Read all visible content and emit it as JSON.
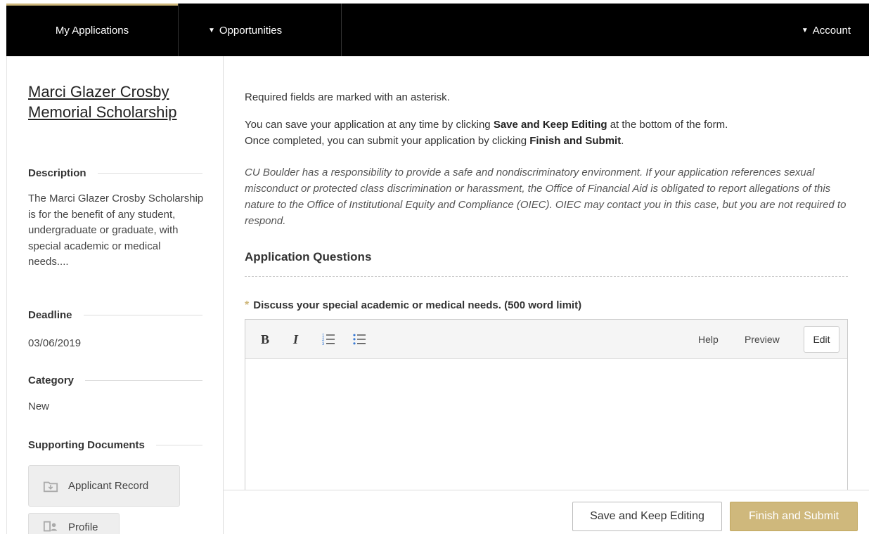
{
  "nav": {
    "my_applications": "My Applications",
    "opportunities": "Opportunities",
    "account": "Account",
    "caret": "▼"
  },
  "sidebar": {
    "title": "Marci Glazer Crosby Memorial Scholarship",
    "description_heading": "Description",
    "description_text": "The Marci Glazer Crosby Scholarship is for the benefit of any student, undergraduate or graduate, with special academic or medical needs....",
    "deadline_heading": "Deadline",
    "deadline_value": "03/06/2019",
    "category_heading": "Category",
    "category_value": "New",
    "supporting_heading": "Supporting Documents",
    "documents": [
      {
        "label": "Applicant Record",
        "icon": "folder-icon"
      },
      {
        "label": "Profile",
        "icon": "profile-card-icon"
      }
    ]
  },
  "main": {
    "required_note": "Required fields are marked with an asterisk.",
    "save_text_1": "You can save your application at any time by clicking ",
    "save_bold": "Save and Keep Editing",
    "save_text_2": " at the bottom of the form.",
    "submit_text_1": "Once completed, you can submit your application by clicking ",
    "submit_bold": "Finish and Submit",
    "submit_text_2": ".",
    "notice": "CU Boulder has a responsibility to provide a safe and nondiscriminatory environment. If your application references sexual misconduct or protected class discrimination or harassment, the Office of Financial Aid is obligated to report allegations of this nature to the Office of Institutional Equity and Compliance (OIEC). OIEC may contact you in this case, but you are not required to respond.",
    "section_heading": "Application Questions",
    "question_star": "*",
    "question": "Discuss your special academic or medical needs. (500 word limit)",
    "answer_value": ""
  },
  "editor": {
    "bold": "B",
    "italic": "I",
    "help": "Help",
    "preview": "Preview",
    "edit": "Edit"
  },
  "actions": {
    "save": "Save and Keep Editing",
    "submit": "Finish and Submit"
  },
  "colors": {
    "nav_bg": "#000000",
    "accent_gold": "#cfb87c"
  }
}
